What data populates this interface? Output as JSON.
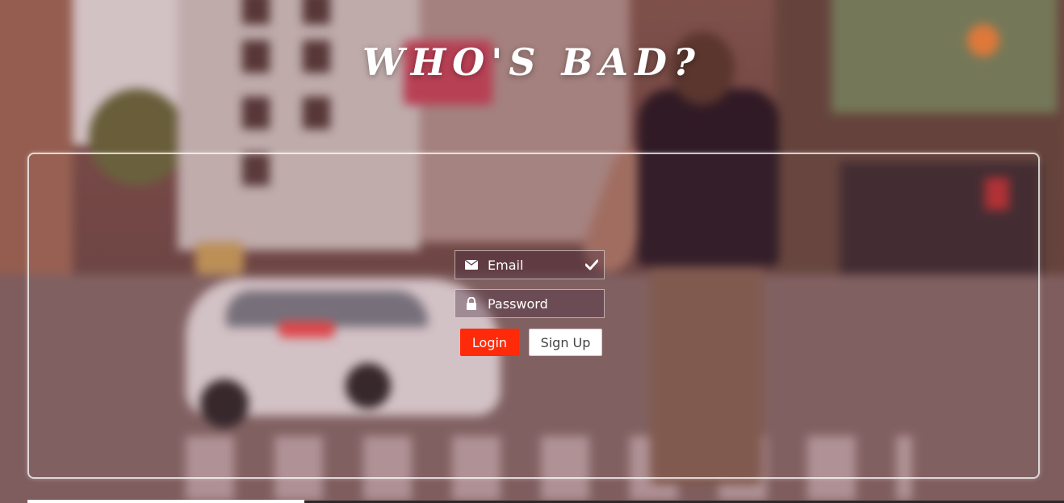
{
  "page": {
    "title": "WHO'S BAD?"
  },
  "login_form": {
    "email": {
      "placeholder": "Email",
      "icon": "envelope-icon",
      "status_icon": "checkmark-icon"
    },
    "password": {
      "placeholder": "Password",
      "icon": "lock-icon"
    },
    "buttons": {
      "login_label": "Login",
      "signup_label": "Sign Up"
    }
  },
  "colors": {
    "login_button": "#ff2a0a",
    "signup_button": "#ffffff",
    "title_text": "#ffffff"
  }
}
